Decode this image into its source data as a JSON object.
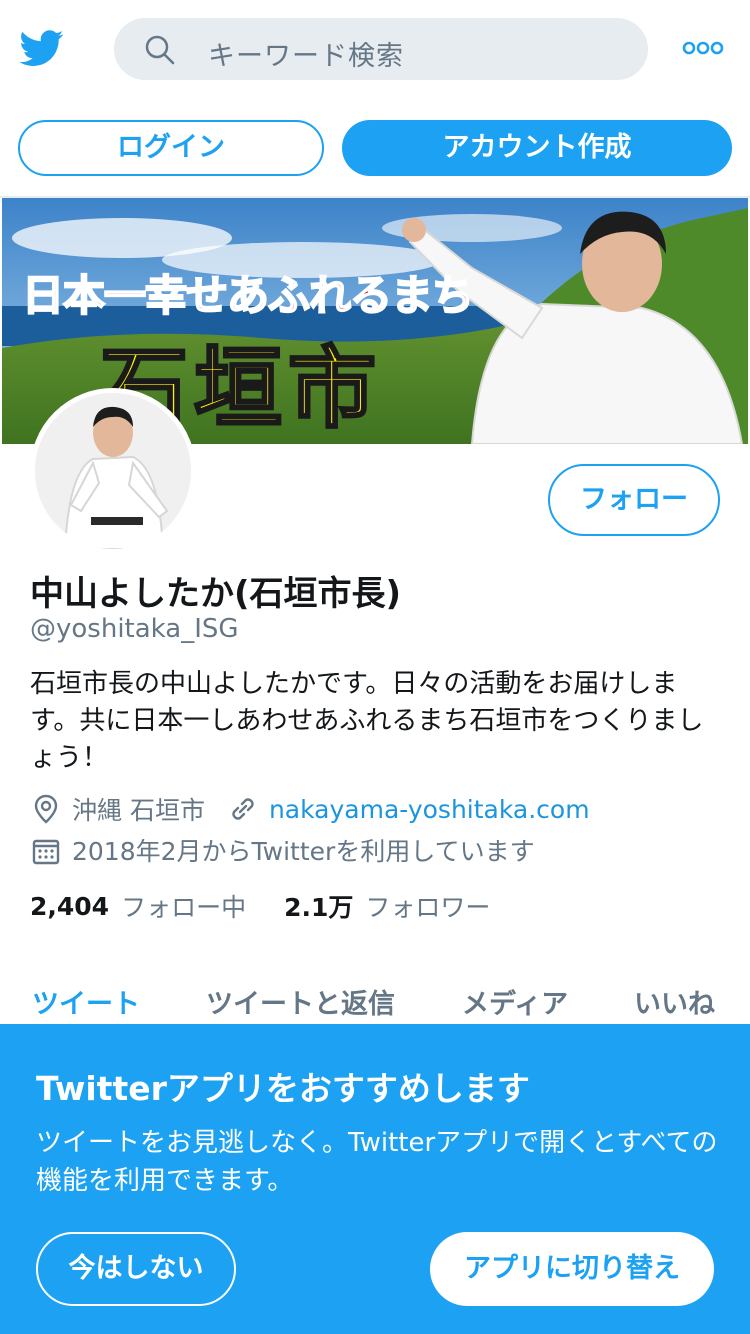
{
  "header": {
    "logo_icon": "twitter-bird-icon",
    "search_placeholder": "キーワード検索",
    "more_icon": "more-dots-icon"
  },
  "auth": {
    "login_label": "ログイン",
    "signup_label": "アカウント作成"
  },
  "banner": {
    "slogan": "日本一幸せあふれるまち",
    "city": "石垣市"
  },
  "profile": {
    "follow_label": "フォロー",
    "name": "中山よしたか(石垣市長)",
    "handle": "@yoshitaka_ISG",
    "bio": "石垣市長の中山よしたかです。日々の活動をお届けします。共に日本一しあわせあふれるまち石垣市をつくりましょう！",
    "location": "沖縄 石垣市",
    "website": "nakayama-yoshitaka.com",
    "joined": "2018年2月からTwitterを利用しています"
  },
  "stats": {
    "following_count": "2,404",
    "following_label": "フォロー中",
    "followers_count": "2.1万",
    "followers_label": "フォロワー"
  },
  "tabs": [
    {
      "label": "ツイート",
      "active": true
    },
    {
      "label": "ツイートと返信",
      "active": false
    },
    {
      "label": "メディア",
      "active": false
    },
    {
      "label": "いいね",
      "active": false
    }
  ],
  "promo": {
    "title": "Twitterアプリをおすすめします",
    "text": "ツイートをお見逃しなく。Twitterアプリで開くとすべての機能を利用できます。",
    "not_now_label": "今はしない",
    "switch_label": "アプリに切り替え"
  },
  "colors": {
    "accent": "#1da1f2",
    "secondary_text": "#657786",
    "search_bg": "#e6ecf0"
  }
}
